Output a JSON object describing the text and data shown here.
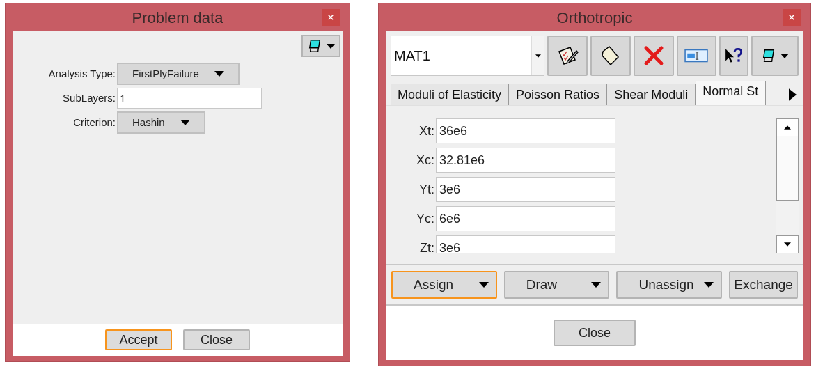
{
  "problem_window": {
    "title": "Problem data",
    "fields": [
      {
        "kind": "dropdown",
        "label": "Analysis Type:",
        "value": "FirstPlyFailure"
      },
      {
        "kind": "text",
        "label": "SubLayers:",
        "value": "1"
      },
      {
        "kind": "dropdown",
        "label": "Criterion:",
        "value": "Hashin"
      }
    ],
    "buttons": [
      {
        "label": "Accept",
        "focused": true,
        "mnemonic": true
      },
      {
        "label": "Close",
        "focused": false,
        "mnemonic": true
      }
    ]
  },
  "material_window": {
    "title": "Orthotropic",
    "material": {
      "value": "MAT1"
    },
    "tabs": [
      {
        "label": "Moduli of Elasticity",
        "selected": false
      },
      {
        "label": "Poisson Ratios",
        "selected": false
      },
      {
        "label": "Shear Moduli",
        "selected": false
      },
      {
        "label": "Normal St",
        "selected": true
      }
    ],
    "fields": [
      {
        "label": "Xt:",
        "value": "36e6"
      },
      {
        "label": "Xc:",
        "value": "32.81e6"
      },
      {
        "label": "Yt:",
        "value": "3e6"
      },
      {
        "label": "Yc:",
        "value": "6e6"
      },
      {
        "label": "Zt:",
        "value": "3e6"
      }
    ],
    "actions": [
      {
        "label": "Assign",
        "focused": true,
        "mnemonic": true,
        "dropdown": true
      },
      {
        "label": "Draw",
        "focused": false,
        "mnemonic": true,
        "dropdown": true
      },
      {
        "label": "Unassign",
        "focused": false,
        "mnemonic": true,
        "dropdown": true
      },
      {
        "label": "Exchange",
        "focused": false,
        "mnemonic": false,
        "dropdown": false
      }
    ],
    "buttons": [
      {
        "label": "Close",
        "focused": false,
        "mnemonic": true
      }
    ]
  }
}
